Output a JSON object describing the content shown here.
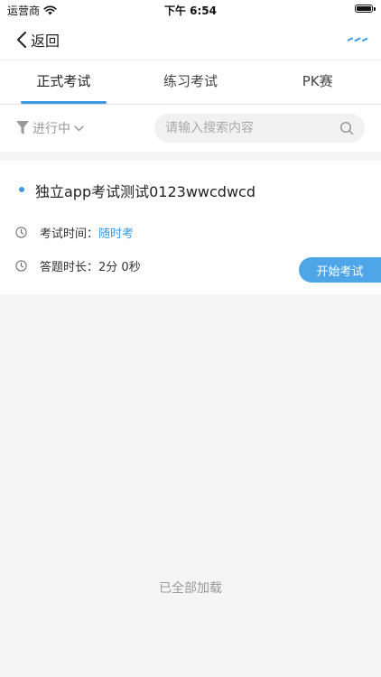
{
  "status_bar": {
    "carrier": "运营商",
    "time": "下午 6:54"
  },
  "nav": {
    "back_label": "返回",
    "accent": "#3a9ae3"
  },
  "tabs": [
    {
      "label": "正式考试",
      "active": true
    },
    {
      "label": "练习考试",
      "active": false
    },
    {
      "label": "PK赛",
      "active": false
    }
  ],
  "filter": {
    "status_label": "进行中",
    "search_placeholder": "请输入搜索内容"
  },
  "exam": {
    "title": "独立app考试测试0123wwcdwcd",
    "time_label": "考试时间：",
    "time_value": "随时考",
    "duration_label": "答题时长：",
    "duration_value": "2分 0秒",
    "start_button": "开始考试"
  },
  "footer": {
    "load_complete": "已全部加载"
  }
}
